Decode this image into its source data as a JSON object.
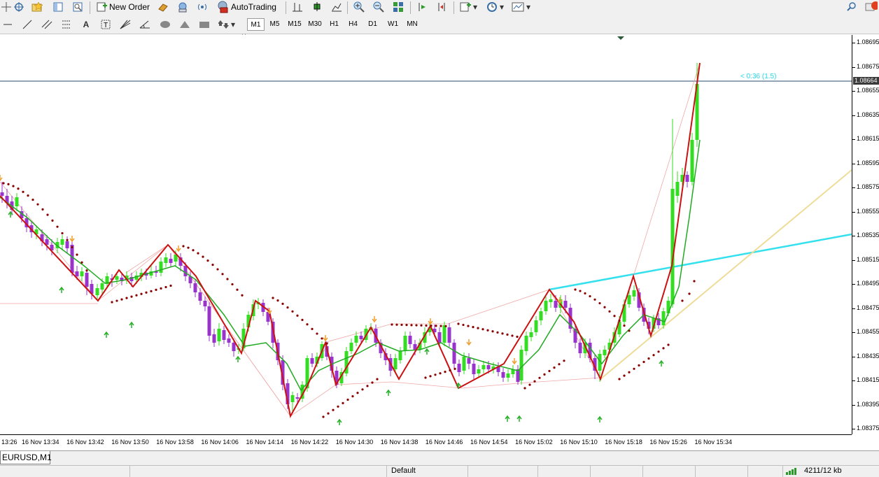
{
  "toolbar": {
    "new_order_label": "New Order",
    "autotrading_label": "AutoTrading"
  },
  "timeframes": [
    "M1",
    "M5",
    "M15",
    "M30",
    "H1",
    "H4",
    "D1",
    "W1",
    "MN"
  ],
  "active_timeframe": "M1",
  "chart": {
    "symbol_tab": "EURUSD,M1",
    "current_price": "1.08664",
    "countdown": "< 0:36 (1.5)",
    "price_labels": [
      "1.08695",
      "1.08675",
      "1.08655",
      "1.08635",
      "1.08615",
      "1.08595",
      "1.08575",
      "1.08555",
      "1.08535",
      "1.08515",
      "1.08495",
      "1.08475",
      "1.08455",
      "1.08435",
      "1.08415",
      "1.08395",
      "1.08375"
    ],
    "time_labels": [
      "13:26",
      "16 Nov 13:34",
      "16 Nov 13:42",
      "16 Nov 13:50",
      "16 Nov 13:58",
      "16 Nov 14:06",
      "16 Nov 14:14",
      "16 Nov 14:22",
      "16 Nov 14:30",
      "16 Nov 14:38",
      "16 Nov 14:46",
      "16 Nov 14:54",
      "16 Nov 15:02",
      "16 Nov 15:10",
      "16 Nov 15:18",
      "16 Nov 15:26",
      "16 Nov 15:34"
    ]
  },
  "statusbar": {
    "profile": "Default",
    "traffic": "4211/12 kb"
  },
  "colors": {
    "bull": "#33dd22",
    "bear": "#9933cc",
    "zigzag": "#cc1111",
    "ma": "#22aa22",
    "sar": "#880000",
    "trend_cyan": "#33e0ee",
    "trend_yellow": "#eedc99"
  }
}
